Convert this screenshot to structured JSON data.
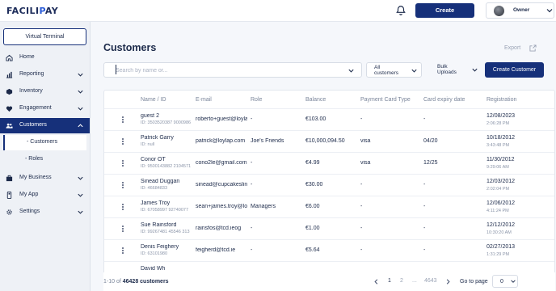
{
  "app": {
    "logo_main": "FACILI",
    "logo_dot": "P",
    "logo_end": "AY"
  },
  "header": {
    "create_label": "Create",
    "user_name": "Owner"
  },
  "sidebar": {
    "virtual_terminal": "Virtual Terminal",
    "items": [
      {
        "label": "Home",
        "icon": "home-icon"
      },
      {
        "label": "Reporting",
        "icon": "chart-icon"
      },
      {
        "label": "Inventory",
        "icon": "box-icon"
      },
      {
        "label": "Engagement",
        "icon": "heart-icon"
      },
      {
        "label": "Customers",
        "icon": "users-icon"
      },
      {
        "label": "My Business",
        "icon": "briefcase-icon"
      },
      {
        "label": "My App",
        "icon": "phone-icon"
      },
      {
        "label": "Settings",
        "icon": "gear-icon"
      }
    ],
    "sub_items": [
      {
        "label": "- Customers"
      },
      {
        "label": "- Roles"
      }
    ]
  },
  "main": {
    "title": "Customers",
    "export_label": "Export",
    "search_placeholder": "Search by name or...",
    "filter_line1": "All",
    "filter_line2": "customers",
    "bulk_line1": "Bulk",
    "bulk_line2": "Uploads",
    "create_customer_label": "Create Customer"
  },
  "table": {
    "columns": [
      "Name / ID",
      "E-mail",
      "Role",
      "Balance",
      "Payment Card Type",
      "Card expiry date",
      "Registration"
    ],
    "rows": [
      {
        "name": "guest 2",
        "id": "ID: 3503520387 9000986",
        "email": "roberto+guest@loyla",
        "role": "-",
        "balance": "€103.00",
        "card_type": "-",
        "expiry": "-",
        "reg_date": "12/08/2023",
        "reg_time": "2:06:28 PM"
      },
      {
        "name": "Patrick Garry",
        "id": "ID: null",
        "email": "patrick@loylap.com",
        "role": "Joe's Friends",
        "balance": "€10,000,094.50",
        "card_type": "visa",
        "expiry": "04/20",
        "reg_date": "10/18/2012",
        "reg_time": "3:43:48 PM"
      },
      {
        "name": "Conor OT",
        "id": "ID: 9500143882 2104571",
        "email": "cono2le@gmail.com",
        "role": "-",
        "balance": "€4.99",
        "card_type": "visa",
        "expiry": "12/25",
        "reg_date": "11/30/2012",
        "reg_time": "9:29:06 AM"
      },
      {
        "name": "Sinead Duggan",
        "id": "ID: 46684833",
        "email": "sinead@cupcakeslin",
        "role": "-",
        "balance": "€30.00",
        "card_type": "-",
        "expiry": "-",
        "reg_date": "12/03/2012",
        "reg_time": "2:02:04 PM"
      },
      {
        "name": "James Troy",
        "id": "ID: 67058997 92740077",
        "email": "sean+james.troy@lo",
        "role": "Managers",
        "balance": "€6.00",
        "card_type": "-",
        "expiry": "-",
        "reg_date": "12/06/2012",
        "reg_time": "4:11:24 PM"
      },
      {
        "name": "Sue Rainsford",
        "id": "ID: 99267481 45546 313",
        "email": "rainsfos@tcd.ieog",
        "role": "-",
        "balance": "€1.00",
        "card_type": "-",
        "expiry": "-",
        "reg_date": "12/12/2012",
        "reg_time": "10:30:20 AM"
      },
      {
        "name": "Denis Feighery",
        "id": "ID: 63101980",
        "email": "feigherd@tcd.ie",
        "role": "-",
        "balance": "€5.64",
        "card_type": "-",
        "expiry": "-",
        "reg_date": "02/27/2013",
        "reg_time": "1:31:29 PM"
      },
      {
        "name": "David Wh",
        "id": "",
        "email": "",
        "role": "",
        "balance": "",
        "card_type": "",
        "expiry": "",
        "reg_date": "",
        "reg_time": ""
      }
    ]
  },
  "footer": {
    "range_text": "1-10 of ",
    "total": "46428 customers",
    "pages": [
      "1",
      "2",
      "...",
      "4643"
    ],
    "goto_label": "Go to page",
    "goto_value": "0"
  },
  "colors": {
    "primary": "#16307a",
    "accent": "#2a5bd7",
    "text": "#1c2a4a",
    "muted": "#7a859a"
  }
}
